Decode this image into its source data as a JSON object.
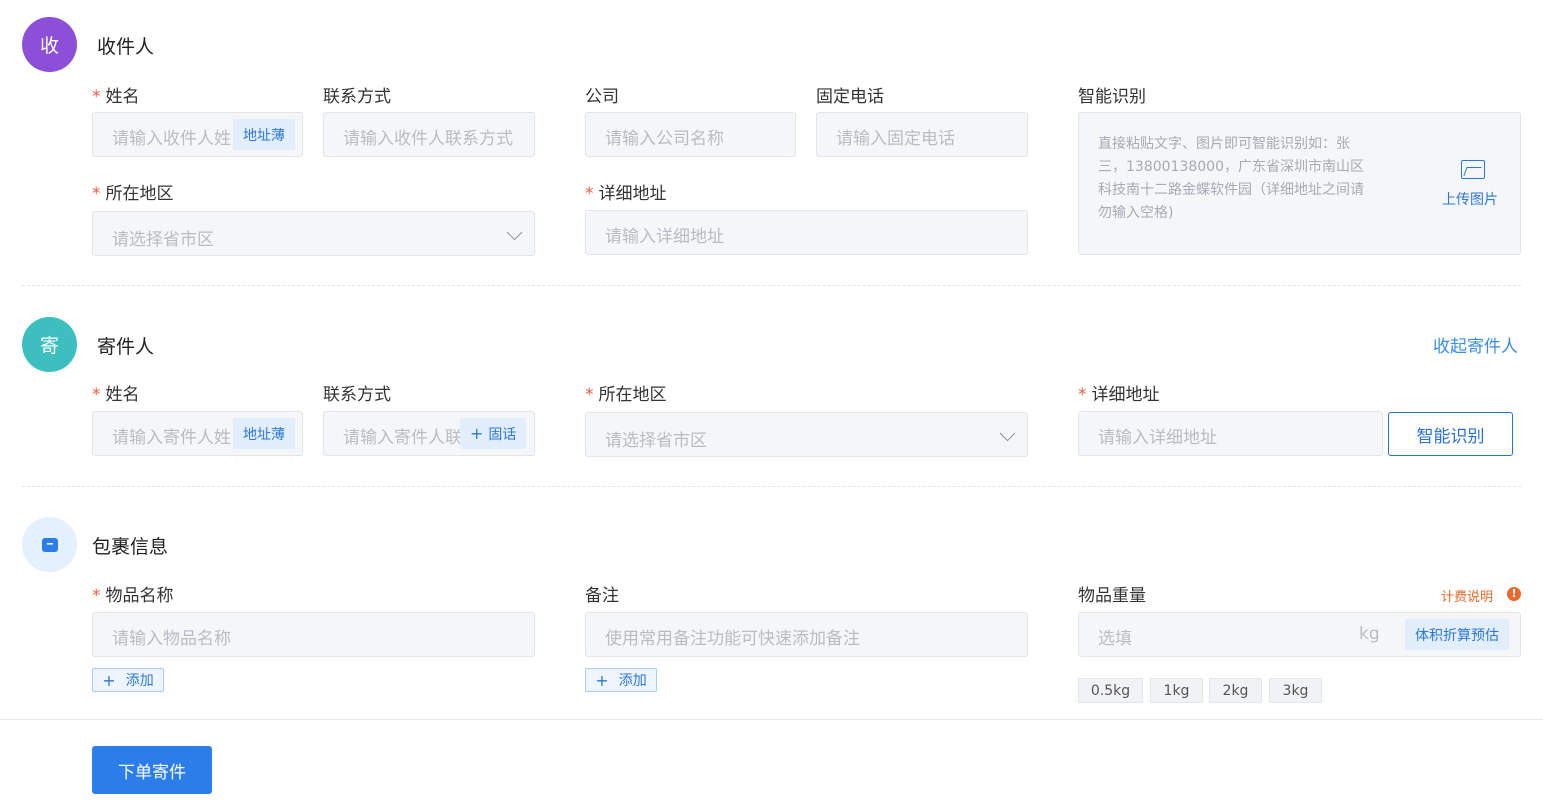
{
  "recipient": {
    "badge": "收",
    "title": "收件人",
    "name_label": "姓名",
    "name_placeholder": "请输入收件人姓名",
    "address_book": "地址薄",
    "contact_label": "联系方式",
    "contact_placeholder": "请输入收件人联系方式",
    "company_label": "公司",
    "company_placeholder": "请输入公司名称",
    "phone_label": "固定电话",
    "phone_placeholder": "请输入固定电话",
    "region_label": "所在地区",
    "region_placeholder": "请选择省市区",
    "detail_label": "详细地址",
    "detail_placeholder": "请输入详细地址",
    "smart_label": "智能识别",
    "smart_hint": "直接粘贴文字、图片即可智能识别如：张三，13800138000，广东省深圳市南山区科技南十二路金蝶软件园（详细地址之间请勿输入空格)",
    "upload_label": "上传图片"
  },
  "sender": {
    "badge": "寄",
    "title": "寄件人",
    "collapse_link": "收起寄件人",
    "name_label": "姓名",
    "name_placeholder": "请输入寄件人姓名",
    "address_book": "地址薄",
    "contact_label": "联系方式",
    "contact_placeholder": "请输入寄件人联系方式",
    "landline_button": "固话",
    "region_label": "所在地区",
    "region_placeholder": "请选择省市区",
    "detail_label": "详细地址",
    "detail_placeholder": "请输入详细地址",
    "smart_button": "智能识别"
  },
  "package": {
    "title": "包裹信息",
    "item_label": "物品名称",
    "item_placeholder": "请输入物品名称",
    "add_label": "添加",
    "note_label": "备注",
    "note_placeholder": "使用常用备注功能可快速添加备注",
    "weight_label": "物品重量",
    "pricing_link": "计费说明",
    "weight_placeholder": "选填",
    "weight_unit": "kg",
    "volume_button": "体积折算预估",
    "weights": [
      "0.5kg",
      "1kg",
      "2kg",
      "3kg"
    ]
  },
  "footer": {
    "submit": "下单寄件"
  },
  "icons": {
    "pkg_icon": "box-icon",
    "upload_icon": "image-icon",
    "info_icon": "exclamation-icon",
    "chevron": "chevron-down-icon",
    "plus": "plus-icon"
  },
  "colors": {
    "primary": "#2b7de9",
    "recipient_badge": "#8b4fd8",
    "sender_badge": "#3dbfbf",
    "required": "#f05b3f",
    "warning": "#e86a2c"
  }
}
